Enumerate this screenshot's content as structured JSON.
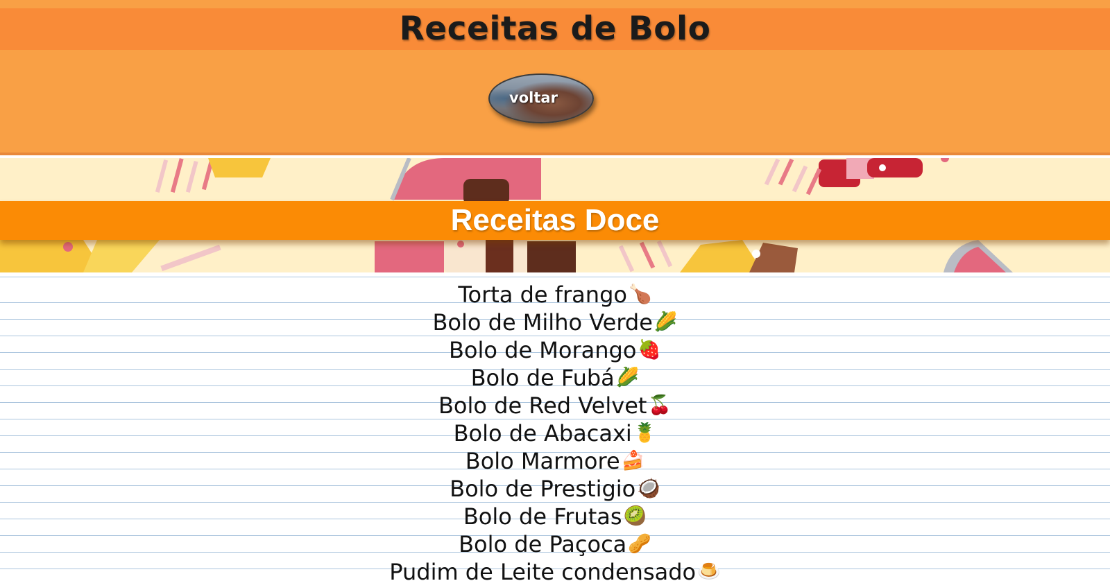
{
  "header": {
    "title": "Receitas de Bolo",
    "back_button_label": "voltar"
  },
  "banner": {
    "section_title": "Receitas Doce"
  },
  "recipes": [
    {
      "label": "Torta de frango",
      "icon": "🍗",
      "icon_name": "chicken-leg-icon"
    },
    {
      "label": "Bolo de Milho Verde",
      "icon": "🌽",
      "icon_name": "corn-icon"
    },
    {
      "label": "Bolo de Morango",
      "icon": "🍓",
      "icon_name": "strawberry-icon"
    },
    {
      "label": "Bolo de Fubá",
      "icon": "🌽",
      "icon_name": "corn-icon"
    },
    {
      "label": "Bolo de Red Velvet",
      "icon": "🍒",
      "icon_name": "cherry-icon"
    },
    {
      "label": "Bolo de Abacaxi",
      "icon": "🍍",
      "icon_name": "pineapple-icon"
    },
    {
      "label": "Bolo Marmore",
      "icon": "🍰",
      "icon_name": "cake-slice-icon"
    },
    {
      "label": "Bolo de Prestigio",
      "icon": "🥥",
      "icon_name": "coconut-icon"
    },
    {
      "label": "Bolo de Frutas",
      "icon": "🥝",
      "icon_name": "kiwi-icon"
    },
    {
      "label": "Bolo de Paçoca",
      "icon": "🥜",
      "icon_name": "peanut-icon"
    },
    {
      "label": "Pudim de Leite condensado",
      "icon": "🍮",
      "icon_name": "pudding-icon"
    }
  ],
  "colors": {
    "header_bg": "#f9a045",
    "title_band": "#f98b38",
    "section_band": "#fb8b05",
    "banner_bg": "#fff0c8",
    "notebook_line": "#a9c4dd"
  }
}
